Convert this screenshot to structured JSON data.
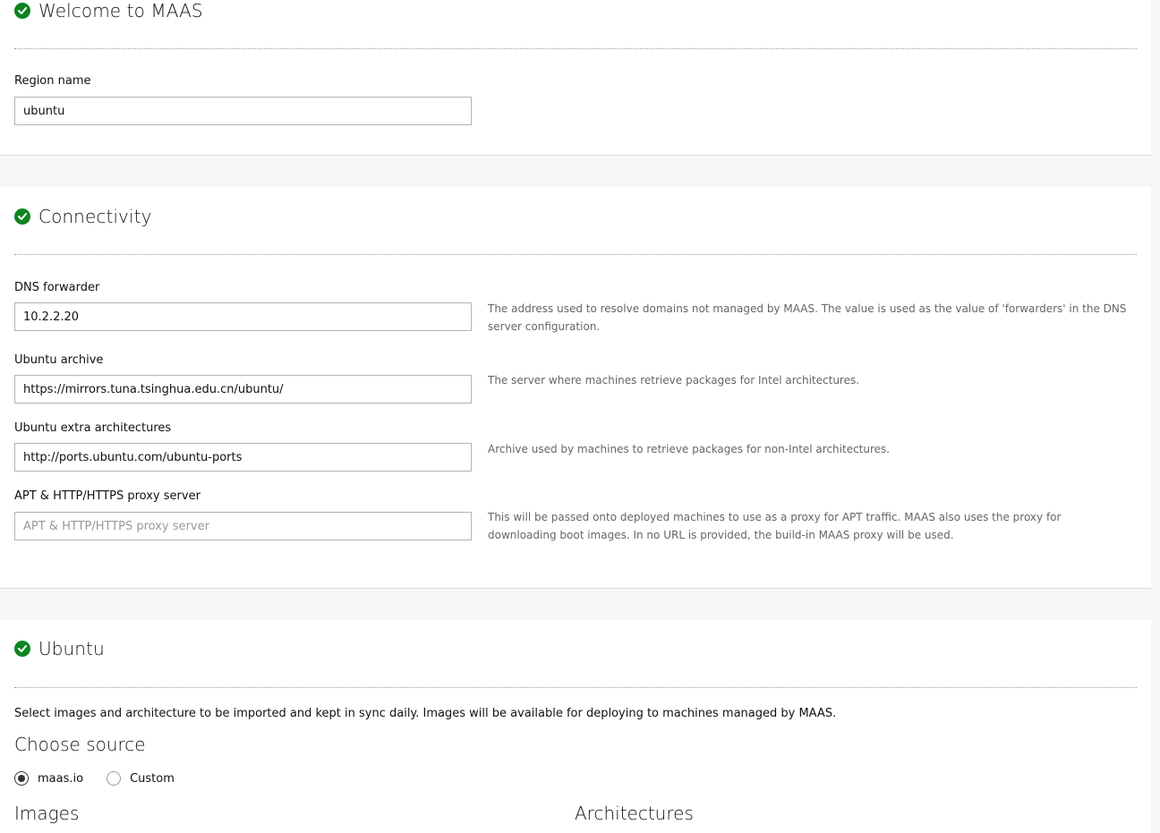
{
  "welcome": {
    "title": "Welcome to MAAS",
    "region_label": "Region name",
    "region_value": "ubuntu"
  },
  "connectivity": {
    "title": "Connectivity",
    "fields": [
      {
        "label": "DNS forwarder",
        "value": "10.2.2.20",
        "placeholder": "",
        "help": "The address used to resolve domains not managed by MAAS. The value is used as the value of 'forwarders' in the DNS server configuration."
      },
      {
        "label": "Ubuntu archive",
        "value": "https://mirrors.tuna.tsinghua.edu.cn/ubuntu/",
        "placeholder": "",
        "help": "The server where machines retrieve packages for Intel architectures."
      },
      {
        "label": "Ubuntu extra architectures",
        "value": "http://ports.ubuntu.com/ubuntu-ports",
        "placeholder": "",
        "help": "Archive used by machines to retrieve packages for non-Intel architectures."
      },
      {
        "label": "APT & HTTP/HTTPS proxy server",
        "value": "",
        "placeholder": "APT & HTTP/HTTPS proxy server",
        "help": "This will be passed onto deployed machines to use as a proxy for APT traffic. MAAS also uses the proxy for downloading boot images. In no URL is provided, the build-in MAAS proxy will be used."
      }
    ]
  },
  "ubuntu": {
    "title": "Ubuntu",
    "description": "Select images and architecture to be imported and kept in sync daily. Images will be available for deploying to machines managed by MAAS.",
    "choose_source": "Choose source",
    "sources": [
      {
        "label": "maas.io",
        "checked": true
      },
      {
        "label": "Custom",
        "checked": false
      }
    ],
    "images_heading": "Images",
    "architectures_heading": "Architectures"
  },
  "colors": {
    "success": "#0e8420",
    "page_background": "#f7f7f7",
    "card_background": "#ffffff"
  }
}
